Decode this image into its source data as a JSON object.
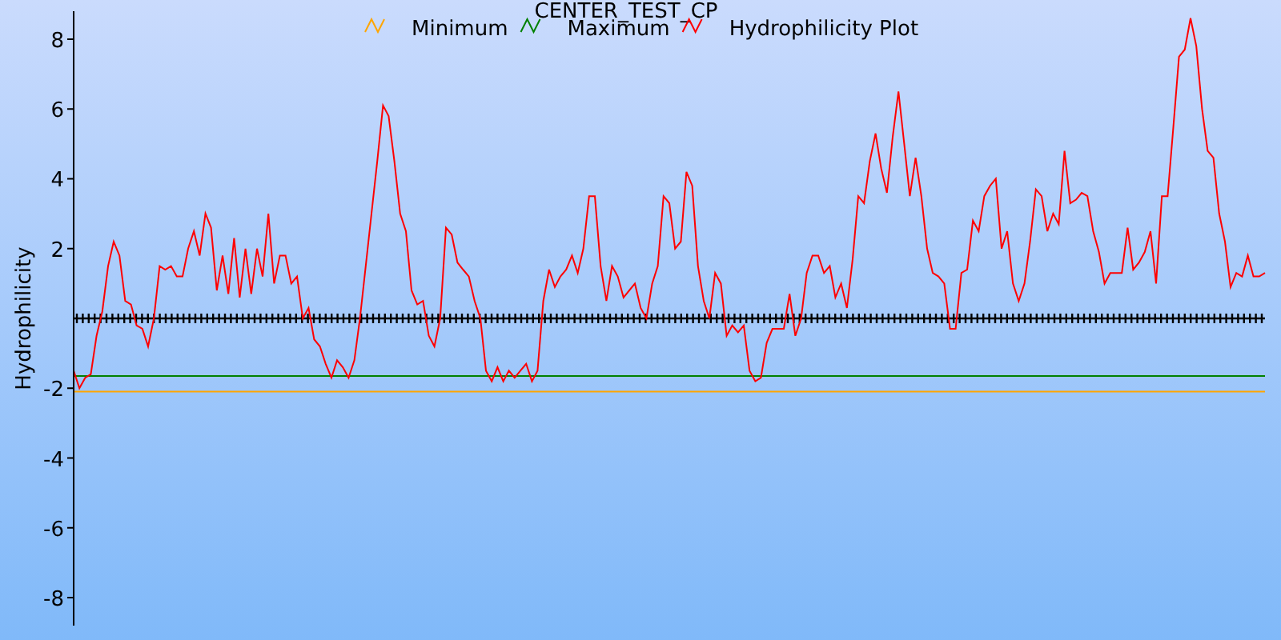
{
  "chart_data": {
    "type": "line",
    "title": "CENTER_TEST_CP",
    "ylabel": "Hydrophilicity",
    "ylim": [
      -8.8,
      8.8
    ],
    "yticks": [
      -8,
      -6,
      -4,
      -2,
      2,
      4,
      6,
      8
    ],
    "legend": "top",
    "categories": [
      null,
      null,
      null,
      null,
      null,
      null,
      null,
      null,
      null,
      null,
      null,
      null,
      null,
      null,
      null,
      null,
      null,
      null,
      null,
      null,
      null,
      null,
      null,
      null,
      null,
      null,
      null,
      null,
      null,
      null,
      null,
      null,
      null,
      null,
      null,
      null,
      null,
      null,
      null,
      null,
      null,
      null,
      null,
      null,
      null,
      null,
      null,
      null,
      null,
      null,
      null,
      null,
      null,
      null,
      null,
      null,
      null,
      null,
      null,
      null,
      null,
      null,
      null,
      null,
      null,
      null,
      null,
      null,
      null,
      null,
      null,
      null,
      null,
      null,
      null,
      null,
      null,
      null,
      null,
      null,
      null,
      null,
      null,
      null,
      null,
      null,
      null,
      null,
      null,
      null,
      null,
      null,
      null,
      null,
      null,
      null,
      null,
      null,
      null,
      null,
      null,
      null,
      null,
      null,
      null,
      null,
      null,
      null,
      null,
      null,
      null,
      null,
      null,
      null,
      null,
      null,
      null,
      null,
      null,
      null,
      null,
      null,
      null,
      null,
      null,
      null,
      null,
      null,
      null,
      null,
      null,
      null,
      null,
      null,
      null,
      null,
      null,
      null,
      null,
      null,
      null,
      null,
      null,
      null,
      null,
      null,
      null,
      null,
      null,
      null,
      null,
      null,
      null,
      null,
      null,
      null,
      null,
      null,
      null,
      null,
      null,
      null,
      null,
      null,
      null,
      null,
      null,
      null,
      null,
      null,
      null,
      null,
      null,
      null,
      null,
      null,
      null,
      null,
      null,
      null,
      null,
      null,
      null,
      null,
      null,
      null,
      null,
      null,
      null,
      null,
      null,
      null,
      null,
      null,
      null,
      null,
      null,
      null,
      null,
      null,
      null,
      null,
      null,
      null,
      null,
      null,
      null,
      null,
      null
    ],
    "series": [
      {
        "name": "Minimum",
        "color": "#ffa500",
        "values": [
          -2.1,
          -2.1,
          -2.1,
          -2.1,
          -2.1,
          -2.1,
          -2.1,
          -2.1,
          -2.1,
          -2.1,
          -2.1,
          -2.1,
          -2.1,
          -2.1,
          -2.1,
          -2.1,
          -2.1,
          -2.1,
          -2.1,
          -2.1,
          -2.1,
          -2.1,
          -2.1,
          -2.1,
          -2.1,
          -2.1,
          -2.1,
          -2.1,
          -2.1,
          -2.1,
          -2.1,
          -2.1,
          -2.1,
          -2.1,
          -2.1,
          -2.1,
          -2.1,
          -2.1,
          -2.1,
          -2.1,
          -2.1,
          -2.1,
          -2.1,
          -2.1,
          -2.1,
          -2.1,
          -2.1,
          -2.1,
          -2.1,
          -2.1,
          -2.1,
          -2.1,
          -2.1,
          -2.1,
          -2.1,
          -2.1,
          -2.1,
          -2.1,
          -2.1,
          -2.1,
          -2.1,
          -2.1,
          -2.1,
          -2.1,
          -2.1,
          -2.1,
          -2.1,
          -2.1,
          -2.1,
          -2.1,
          -2.1,
          -2.1,
          -2.1,
          -2.1,
          -2.1,
          -2.1,
          -2.1,
          -2.1,
          -2.1,
          -2.1,
          -2.1,
          -2.1,
          -2.1,
          -2.1,
          -2.1,
          -2.1,
          -2.1,
          -2.1,
          -2.1,
          -2.1,
          -2.1,
          -2.1,
          -2.1,
          -2.1,
          -2.1,
          -2.1,
          -2.1,
          -2.1,
          -2.1,
          -2.1,
          -2.1,
          -2.1,
          -2.1,
          -2.1,
          -2.1,
          -2.1,
          -2.1,
          -2.1,
          -2.1,
          -2.1,
          -2.1,
          -2.1,
          -2.1,
          -2.1,
          -2.1,
          -2.1,
          -2.1,
          -2.1,
          -2.1,
          -2.1,
          -2.1,
          -2.1,
          -2.1,
          -2.1,
          -2.1,
          -2.1,
          -2.1,
          -2.1,
          -2.1,
          -2.1,
          -2.1,
          -2.1,
          -2.1,
          -2.1,
          -2.1,
          -2.1,
          -2.1,
          -2.1,
          -2.1,
          -2.1,
          -2.1,
          -2.1,
          -2.1,
          -2.1,
          -2.1,
          -2.1,
          -2.1,
          -2.1,
          -2.1,
          -2.1,
          -2.1,
          -2.1,
          -2.1,
          -2.1,
          -2.1,
          -2.1,
          -2.1,
          -2.1,
          -2.1,
          -2.1,
          -2.1,
          -2.1,
          -2.1,
          -2.1,
          -2.1,
          -2.1,
          -2.1,
          -2.1,
          -2.1,
          -2.1,
          -2.1,
          -2.1,
          -2.1,
          -2.1,
          -2.1,
          -2.1,
          -2.1,
          -2.1,
          -2.1,
          -2.1,
          -2.1,
          -2.1,
          -2.1,
          -2.1,
          -2.1,
          -2.1,
          -2.1,
          -2.1,
          -2.1,
          -2.1,
          -2.1,
          -2.1,
          -2.1,
          -2.1,
          -2.1,
          -2.1,
          -2.1,
          -2.1,
          -2.1,
          -2.1,
          -2.1,
          -2.1,
          -2.1,
          -2.1,
          -2.1,
          -2.1,
          -2.1,
          -2.1,
          -2.1
        ]
      },
      {
        "name": "Maximum",
        "color": "#008000",
        "values": [
          -1.65,
          -1.65,
          -1.65,
          -1.65,
          -1.65,
          -1.65,
          -1.65,
          -1.65,
          -1.65,
          -1.65,
          -1.65,
          -1.65,
          -1.65,
          -1.65,
          -1.65,
          -1.65,
          -1.65,
          -1.65,
          -1.65,
          -1.65,
          -1.65,
          -1.65,
          -1.65,
          -1.65,
          -1.65,
          -1.65,
          -1.65,
          -1.65,
          -1.65,
          -1.65,
          -1.65,
          -1.65,
          -1.65,
          -1.65,
          -1.65,
          -1.65,
          -1.65,
          -1.65,
          -1.65,
          -1.65,
          -1.65,
          -1.65,
          -1.65,
          -1.65,
          -1.65,
          -1.65,
          -1.65,
          -1.65,
          -1.65,
          -1.65,
          -1.65,
          -1.65,
          -1.65,
          -1.65,
          -1.65,
          -1.65,
          -1.65,
          -1.65,
          -1.65,
          -1.65,
          -1.65,
          -1.65,
          -1.65,
          -1.65,
          -1.65,
          -1.65,
          -1.65,
          -1.65,
          -1.65,
          -1.65,
          -1.65,
          -1.65,
          -1.65,
          -1.65,
          -1.65,
          -1.65,
          -1.65,
          -1.65,
          -1.65,
          -1.65,
          -1.65,
          -1.65,
          -1.65,
          -1.65,
          -1.65,
          -1.65,
          -1.65,
          -1.65,
          -1.65,
          -1.65,
          -1.65,
          -1.65,
          -1.65,
          -1.65,
          -1.65,
          -1.65,
          -1.65,
          -1.65,
          -1.65,
          -1.65,
          -1.65,
          -1.65,
          -1.65,
          -1.65,
          -1.65,
          -1.65,
          -1.65,
          -1.65,
          -1.65,
          -1.65,
          -1.65,
          -1.65,
          -1.65,
          -1.65,
          -1.65,
          -1.65,
          -1.65,
          -1.65,
          -1.65,
          -1.65,
          -1.65,
          -1.65,
          -1.65,
          -1.65,
          -1.65,
          -1.65,
          -1.65,
          -1.65,
          -1.65,
          -1.65,
          -1.65,
          -1.65,
          -1.65,
          -1.65,
          -1.65,
          -1.65,
          -1.65,
          -1.65,
          -1.65,
          -1.65,
          -1.65,
          -1.65,
          -1.65,
          -1.65,
          -1.65,
          -1.65,
          -1.65,
          -1.65,
          -1.65,
          -1.65,
          -1.65,
          -1.65,
          -1.65,
          -1.65,
          -1.65,
          -1.65,
          -1.65,
          -1.65,
          -1.65,
          -1.65,
          -1.65,
          -1.65,
          -1.65,
          -1.65,
          -1.65,
          -1.65,
          -1.65,
          -1.65,
          -1.65,
          -1.65,
          -1.65,
          -1.65,
          -1.65,
          -1.65,
          -1.65,
          -1.65,
          -1.65,
          -1.65,
          -1.65,
          -1.65,
          -1.65,
          -1.65,
          -1.65,
          -1.65,
          -1.65,
          -1.65,
          -1.65,
          -1.65,
          -1.65,
          -1.65,
          -1.65,
          -1.65,
          -1.65,
          -1.65,
          -1.65,
          -1.65,
          -1.65,
          -1.65,
          -1.65,
          -1.65,
          -1.65,
          -1.65,
          -1.65,
          -1.65,
          -1.65,
          -1.65,
          -1.65,
          -1.65,
          -1.65
        ]
      },
      {
        "name": "Hydrophilicity Plot",
        "color": "#ff0000",
        "values": [
          -1.5,
          -2.0,
          -1.7,
          -1.6,
          -0.5,
          0.2,
          1.5,
          2.2,
          1.8,
          0.5,
          0.4,
          -0.2,
          -0.3,
          -0.8,
          0.0,
          1.5,
          1.4,
          1.5,
          1.2,
          1.2,
          2.0,
          2.5,
          1.8,
          3.0,
          2.6,
          0.8,
          1.8,
          0.7,
          2.3,
          0.6,
          2.0,
          0.7,
          2.0,
          1.2,
          3.0,
          1.0,
          1.8,
          1.8,
          1.0,
          1.2,
          0.0,
          0.3,
          -0.6,
          -0.8,
          -1.3,
          -1.7,
          -1.2,
          -1.4,
          -1.7,
          -1.2,
          0.0,
          1.5,
          3.0,
          4.5,
          6.1,
          5.8,
          4.5,
          3.0,
          2.5,
          0.8,
          0.4,
          0.5,
          -0.5,
          -0.8,
          0.0,
          2.6,
          2.4,
          1.6,
          1.4,
          1.2,
          0.5,
          0.0,
          -1.5,
          -1.8,
          -1.4,
          -1.8,
          -1.5,
          -1.7,
          -1.5,
          -1.3,
          -1.8,
          -1.5,
          0.5,
          1.4,
          0.9,
          1.2,
          1.4,
          1.8,
          1.3,
          2.0,
          3.5,
          3.5,
          1.5,
          0.5,
          1.5,
          1.2,
          0.6,
          0.8,
          1.0,
          0.3,
          0.0,
          1.0,
          1.5,
          3.5,
          3.3,
          2.0,
          2.2,
          4.2,
          3.8,
          1.5,
          0.5,
          0.0,
          1.3,
          1.0,
          -0.5,
          -0.2,
          -0.4,
          -0.2,
          -1.5,
          -1.8,
          -1.7,
          -0.7,
          -0.3,
          -0.3,
          -0.3,
          0.7,
          -0.5,
          0.0,
          1.3,
          1.8,
          1.8,
          1.3,
          1.5,
          0.6,
          1.0,
          0.3,
          1.7,
          3.5,
          3.3,
          4.5,
          5.3,
          4.3,
          3.6,
          5.2,
          6.5,
          5.0,
          3.5,
          4.6,
          3.5,
          2.0,
          1.3,
          1.2,
          1.0,
          -0.3,
          -0.3,
          1.3,
          1.4,
          2.8,
          2.5,
          3.5,
          3.8,
          4.0,
          2.0,
          2.5,
          1.0,
          0.5,
          1.0,
          2.2,
          3.7,
          3.5,
          2.5,
          3.0,
          2.7,
          4.8,
          3.3,
          3.4,
          3.6,
          3.5,
          2.5,
          1.9,
          1.0,
          1.3,
          1.3,
          1.3,
          2.6,
          1.4,
          1.6,
          1.9,
          2.5,
          1.0,
          3.5,
          3.5,
          5.5,
          7.5,
          7.7,
          8.6,
          7.8,
          6.0,
          4.8,
          4.6,
          3.0,
          2.2,
          0.9,
          1.3,
          1.2,
          1.8,
          1.2,
          1.2,
          1.3
        ]
      }
    ]
  }
}
